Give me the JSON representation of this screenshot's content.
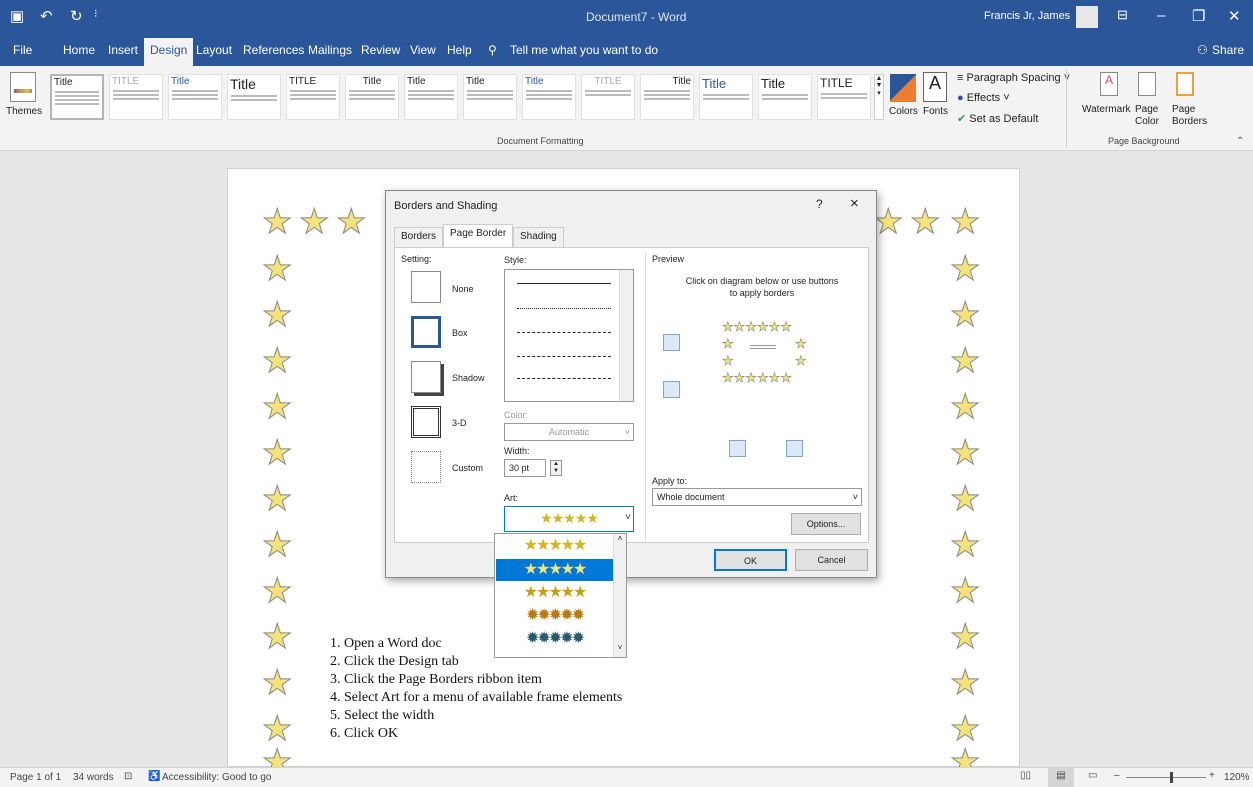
{
  "window": {
    "title": "Document7 - Word",
    "user": "Francis Jr, James",
    "share": "Share"
  },
  "menu_tabs": [
    "File",
    "Home",
    "Insert",
    "Design",
    "Layout",
    "References",
    "Mailings",
    "Review",
    "View",
    "Help"
  ],
  "tell_me": "Tell me what you want to do",
  "ribbon": {
    "themes_label": "Themes",
    "style_thumbs": [
      "Title",
      "TITLE",
      "Title",
      "Title",
      "TITLE",
      "Title",
      "Title",
      "Title",
      "Title",
      "TITLE",
      "Title",
      "Title",
      "TITLE"
    ],
    "colors_label": "Colors",
    "fonts_label": "Fonts",
    "paragraph_spacing": "Paragraph Spacing",
    "effects": "Effects",
    "set_default": "Set as Default",
    "group_document_formatting": "Document Formatting",
    "watermark": "Watermark",
    "page_color": "Page Color",
    "page_borders": "Page Borders",
    "group_page_background": "Page Background"
  },
  "dialog": {
    "title": "Borders and Shading",
    "help": "?",
    "close": "×",
    "tabs": [
      "Borders",
      "Page Border",
      "Shading"
    ],
    "setting_label": "Setting:",
    "settings": [
      "None",
      "Box",
      "Shadow",
      "3-D",
      "Custom"
    ],
    "style_label": "Style:",
    "color_label": "Color:",
    "color_value": "Automatic",
    "width_label": "Width:",
    "width_value": "30 pt",
    "art_label": "Art:",
    "preview_label": "Preview",
    "preview_hint": "Click on diagram below or use buttons to apply borders",
    "apply_to_label": "Apply to:",
    "apply_to_value": "Whole document",
    "options_button": "Options...",
    "ok_button": "OK",
    "cancel_button": "Cancel"
  },
  "art_dropdown": {
    "items": [
      "★★★★★",
      "★★★★★",
      "★★★★★",
      "✹✹✹✹✹",
      "✹✹✹✹✹"
    ],
    "selected_index": 1
  },
  "document": {
    "steps": [
      "1.   Open a Word doc",
      "2.   Click the Design tab",
      "3.   Click the Page Borders ribbon item",
      "4.   Select Art for a menu of available frame elements",
      "5.   Select the width",
      "6.   Click OK"
    ]
  },
  "status": {
    "page": "Page 1 of 1",
    "words": "34 words",
    "accessibility": "Accessibility: Good to go",
    "zoom": "120%"
  },
  "colors": {
    "word_blue": "#2b579a",
    "star_fill": "#f4e27a",
    "selected_art": "#0078d7"
  }
}
